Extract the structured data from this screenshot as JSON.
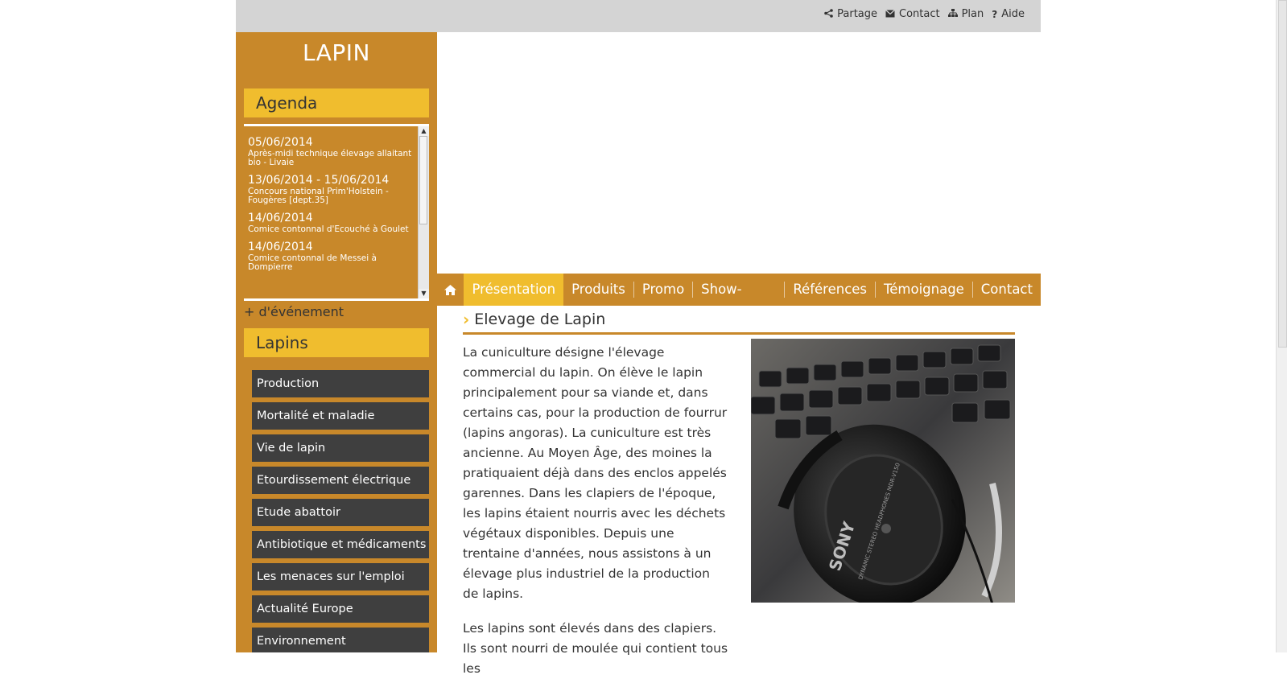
{
  "topbar": {
    "links": [
      {
        "icon": "share-icon",
        "label": "Partage"
      },
      {
        "icon": "envelope-icon",
        "label": "Contact"
      },
      {
        "icon": "sitemap-icon",
        "label": "Plan"
      },
      {
        "icon": "question-icon",
        "label": "Aide"
      }
    ]
  },
  "sidebar": {
    "site_title": "LAPIN",
    "agenda": {
      "header": "Agenda",
      "events": [
        {
          "date": "05/06/2014",
          "title": "Après-midi technique élevage allaitant bio - Livaie"
        },
        {
          "date": "13/06/2014 - 15/06/2014",
          "title": "Concours national Prim'Holstein - Fougères [dept.35]"
        },
        {
          "date": "14/06/2014",
          "title": "Comice contonnal d'Ecouché à Goulet"
        },
        {
          "date": "14/06/2014",
          "title": "Comice contonnal de Messei à Dompierre"
        }
      ],
      "more_link": "+ d'événement"
    },
    "lapins": {
      "header": "Lapins",
      "items": [
        "Production",
        "Mortalité et maladie",
        "Vie de lapin",
        "Etourdissement électrique",
        "Etude abattoir",
        "Antibiotique et médicaments",
        "Les menaces sur l'emploi",
        "Actualité Europe",
        "Environnement"
      ]
    }
  },
  "nav": {
    "home_icon": "home-icon",
    "items": [
      {
        "label": "Présentation",
        "active": true
      },
      {
        "label": "Produits",
        "active": false
      },
      {
        "label": "Promo",
        "active": false
      },
      {
        "label": "Show-Room",
        "active": false
      },
      {
        "label": "Références",
        "active": false
      },
      {
        "label": "Témoignage",
        "active": false
      },
      {
        "label": "Contact",
        "active": false
      }
    ]
  },
  "content": {
    "title": "Elevage de Lapin",
    "paragraph1": "La cuniculture désigne l'élevage commercial du lapin. On élève le lapin principalement pour sa viande et, dans certains cas, pour la production de fourrur (lapins angoras). La cuniculture est très ancienne. Au Moyen Âge, des moines la pratiquaient déjà dans des enclos appelés garennes. Dans les clapiers de l'époque, les lapins étaient nourris avec les déchets végétaux disponibles. Depuis une trentaine d'années, nous assistons à un élevage plus industriel de la production de lapins.",
    "paragraph2": "Les lapins sont élevés dans des clapiers. Ils sont nourri de moulée qui contient tous les",
    "photo_text": {
      "brand": "SONY",
      "model": "DYNAMIC STEREO HEADPHONES MDR-V150"
    }
  },
  "colors": {
    "brand_orange": "#c8882a",
    "accent_yellow": "#f0bd2e",
    "menu_dark": "#3f3f3f",
    "topbar_gray": "#d4d4d4"
  }
}
